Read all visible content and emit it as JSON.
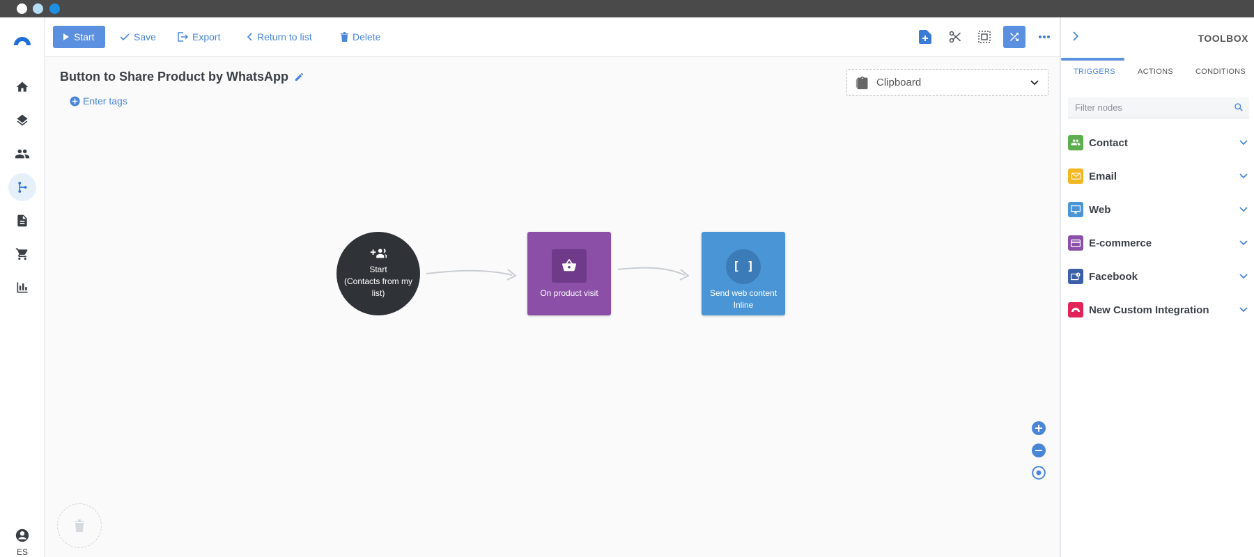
{
  "chrome": {
    "dots": [
      "#ffffff",
      "#b7dcf5",
      "#1e8fe3"
    ]
  },
  "nav": {
    "items": [
      {
        "icon": "home-icon"
      },
      {
        "icon": "layers-icon"
      },
      {
        "icon": "contacts-icon"
      },
      {
        "icon": "flow-branch-icon",
        "active": true
      },
      {
        "icon": "document-icon"
      },
      {
        "icon": "cart-icon"
      },
      {
        "icon": "bar-chart-icon"
      }
    ],
    "language": "ES"
  },
  "toolbar": {
    "start_label": "Start",
    "save_label": "Save",
    "export_label": "Export",
    "return_label": "Return to list",
    "delete_label": "Delete"
  },
  "flow": {
    "title": "Button to Share Product by WhatsApp",
    "tags_label": "Enter tags",
    "clipboard_label": "Clipboard",
    "nodes": {
      "start": {
        "line1": "Start",
        "line2": "(Contacts from my",
        "line3": "list)"
      },
      "product": {
        "label": "On product visit",
        "color": "#8b4fa8"
      },
      "web": {
        "line1": "Send web content",
        "line2": "Inline",
        "symbol": "[ ]",
        "color": "#4a95d6"
      }
    }
  },
  "toolbox": {
    "title": "TOOLBOX",
    "tabs": [
      "TRIGGERS",
      "ACTIONS",
      "CONDITIONS"
    ],
    "active_tab": "TRIGGERS",
    "search_placeholder": "Filter nodes",
    "categories": [
      {
        "label": "Contact",
        "color": "#5cae4e",
        "icon": "contact-group-icon"
      },
      {
        "label": "Email",
        "color": "#f2b824",
        "icon": "envelope-icon"
      },
      {
        "label": "Web",
        "color": "#4a95d6",
        "icon": "monitor-icon"
      },
      {
        "label": "E-commerce",
        "color": "#8b4fa8",
        "icon": "card-icon"
      },
      {
        "label": "Facebook",
        "color": "#3b5fa8",
        "icon": "facebook-icon"
      },
      {
        "label": "New Custom Integration",
        "color": "#e3245a",
        "icon": "custom-integration-icon"
      }
    ]
  }
}
